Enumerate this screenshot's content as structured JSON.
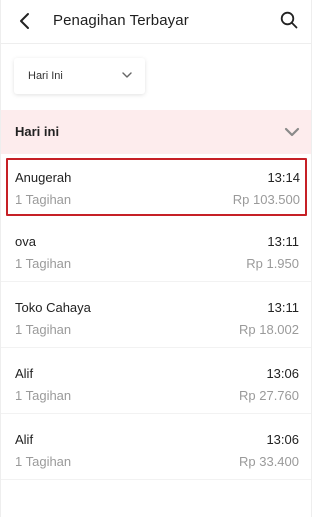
{
  "header": {
    "title": "Penagihan Terbayar"
  },
  "filter": {
    "selected": "Hari Ini"
  },
  "section": {
    "title": "Hari ini"
  },
  "transactions": [
    {
      "name": "Anugerah",
      "time": "13:14",
      "count": "1 Tagihan",
      "amount": "Rp 103.500"
    },
    {
      "name": "ova",
      "time": "13:11",
      "count": "1 Tagihan",
      "amount": "Rp 1.950"
    },
    {
      "name": "Toko Cahaya",
      "time": "13:11",
      "count": "1 Tagihan",
      "amount": "Rp 18.002"
    },
    {
      "name": "Alif",
      "time": "13:06",
      "count": "1 Tagihan",
      "amount": "Rp 27.760"
    },
    {
      "name": "Alif",
      "time": "13:06",
      "count": "1 Tagihan",
      "amount": "Rp 33.400"
    }
  ],
  "colors": {
    "section_bg": "#fdeced",
    "highlight_border": "#c62026",
    "muted_text": "#9a9a9a"
  },
  "icons": {
    "back": "arrow-left-icon",
    "search": "search-icon",
    "filter_chevron": "chevron-down-icon",
    "section_chevron": "chevron-down-icon"
  }
}
